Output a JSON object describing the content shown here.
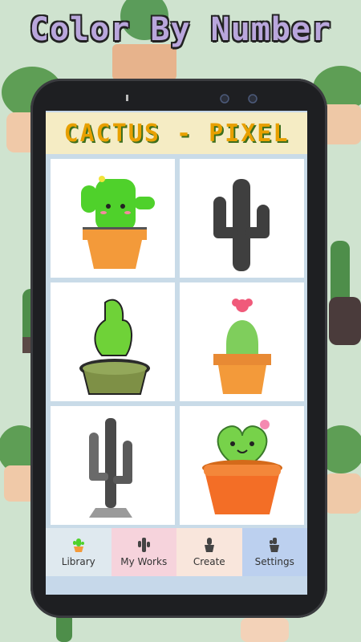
{
  "promo": {
    "title": "Color By Number"
  },
  "app": {
    "banner_title": "CACTUS - PIXEL"
  },
  "library": {
    "tiles": [
      {
        "name": "green-cactus-in-orange-pot"
      },
      {
        "name": "dark-saguaro-silhouette"
      },
      {
        "name": "spiky-cactus-in-olive-pot"
      },
      {
        "name": "round-cactus-with-pink-flower"
      },
      {
        "name": "tall-gray-cactus-on-stand"
      },
      {
        "name": "heart-cactus-in-orange-pot"
      }
    ]
  },
  "tabs": {
    "library": "Library",
    "my_works": "My Works",
    "create": "Create",
    "settings": "Settings"
  },
  "colors": {
    "background": "#cfe3cf",
    "phone_frame": "#1e1f22",
    "banner_bg": "#f5ecc4",
    "cactus_green": "#4fd12b",
    "pot_orange": "#f39a3a"
  }
}
